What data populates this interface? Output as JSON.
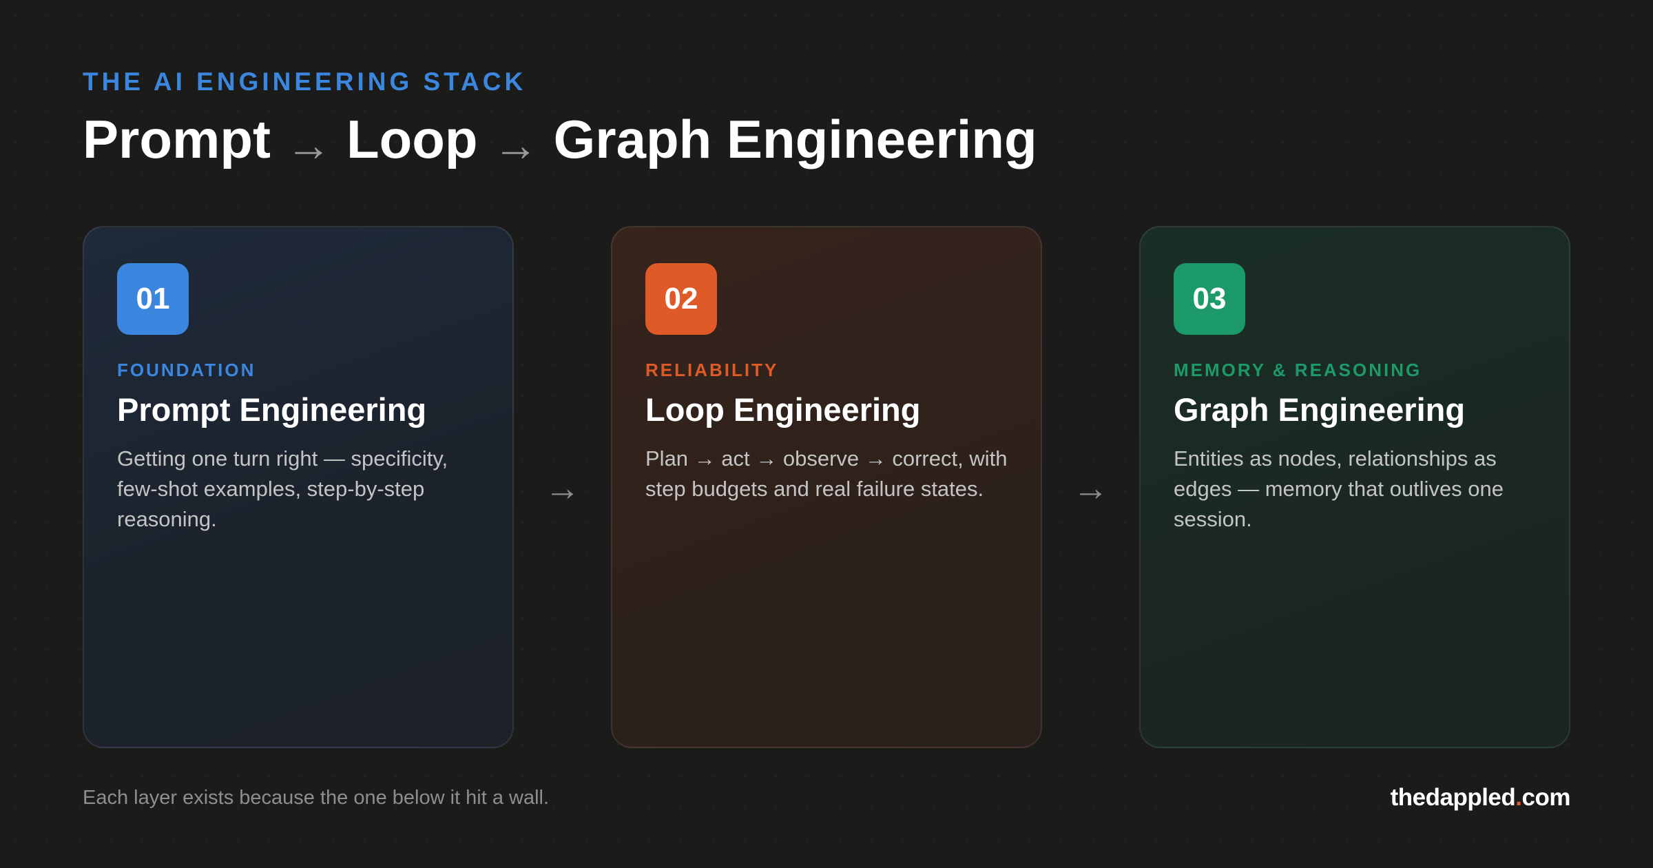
{
  "header": {
    "eyebrow": "THE AI ENGINEERING STACK",
    "title_parts": [
      "Prompt",
      "Loop",
      "Graph Engineering"
    ],
    "separator": "→"
  },
  "cards": [
    {
      "number": "01",
      "kicker": "FOUNDATION",
      "title": "Prompt Engineering",
      "description": "Getting one turn right — specificity, few-shot examples, step-by-step reasoning.",
      "accent": "#3b87e0"
    },
    {
      "number": "02",
      "kicker": "RELIABILITY",
      "title": "Loop Engineering",
      "description": "Plan → act → observe → correct, with step budgets and real failure states.",
      "accent": "#e05a28"
    },
    {
      "number": "03",
      "kicker": "MEMORY & REASONING",
      "title": "Graph Engineering",
      "description": "Entities as nodes, relationships as edges — memory that outlives one session.",
      "accent": "#1c9a6a"
    }
  ],
  "connectors": [
    "→",
    "→"
  ],
  "footer": {
    "note": "Each layer exists because the one below it hit a wall.",
    "brand_name": "thedappled",
    "brand_dot": ".",
    "brand_tld": "com"
  },
  "colors": {
    "background": "#1b1b1a",
    "blue": "#3b87e0",
    "orange": "#e05a28",
    "green": "#1c9a6a"
  }
}
